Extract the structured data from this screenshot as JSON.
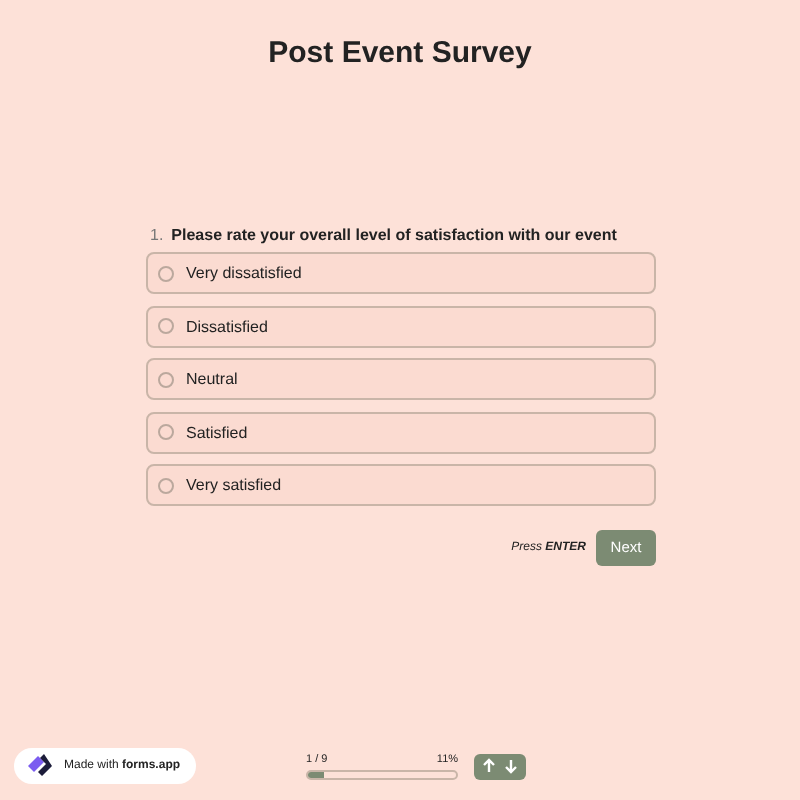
{
  "title": "Post Event Survey",
  "question": {
    "number": "1.",
    "text": "Please rate your overall level of satisfaction with our event",
    "options": [
      {
        "label": "Very dissatisfied",
        "selected": false
      },
      {
        "label": "Dissatisfied",
        "selected": false
      },
      {
        "label": "Neutral",
        "selected": false
      },
      {
        "label": "Satisfied",
        "selected": false
      },
      {
        "label": "Very satisfied",
        "selected": false
      }
    ]
  },
  "hint": "Press **ENTER**",
  "next_button": "Next",
  "badge": "Made with **forms.app**",
  "progress": {
    "count": "1 / 9",
    "percent": "11%",
    "level": 0.11
  }
}
